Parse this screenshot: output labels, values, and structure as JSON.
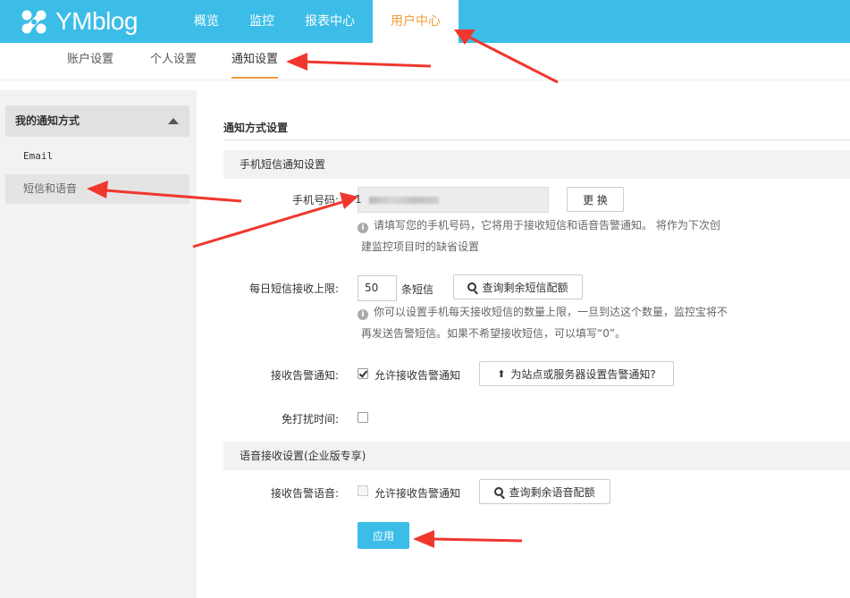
{
  "header": {
    "logo_text": "YMblog",
    "nav": [
      "概览",
      "监控",
      "报表中心",
      "用户中心"
    ],
    "active_nav": "用户中心"
  },
  "subnav": {
    "items": [
      "账户设置",
      "个人设置",
      "通知设置"
    ],
    "active": "通知设置"
  },
  "sidebar": {
    "title": "我的通知方式",
    "items": [
      "Email",
      "短信和语音"
    ],
    "active": "短信和语音"
  },
  "main": {
    "section_title": "通知方式设置",
    "sms_group": {
      "title": "手机短信通知设置",
      "phone_label": "手机号码:",
      "phone_value": "1",
      "change_button": "更 换",
      "phone_hint_line1": "请填写您的手机号码，它将用于接收短信和语音告警通知。 将作为下次创",
      "phone_hint_line2": "建监控项目时的缺省设置",
      "daily_limit_label": "每日短信接收上限:",
      "daily_limit_value": "50",
      "daily_limit_unit": "条短信",
      "query_sms_button": "查询剩余短信配额",
      "limit_hint_line1": "你可以设置手机每天接收短信的数量上限，一旦到达这个数量，监控宝将不",
      "limit_hint_line2": "再发送告警短信。如果不希望接收短信，可以填写“0”。",
      "receive_alert_label": "接收告警通知:",
      "receive_alert_checkbox": "允许接收告警通知",
      "receive_alert_checked": true,
      "set_alert_button": "为站点或服务器设置告警通知?",
      "dnd_label": "免打扰时间:",
      "dnd_checked": false
    },
    "voice_group": {
      "title": "语音接收设置(企业版专享)",
      "receive_voice_label": "接收告警语音:",
      "receive_voice_checkbox": "允许接收告警通知",
      "receive_voice_checked": false,
      "query_voice_button": "查询剩余语音配额"
    },
    "apply_button": "应用"
  },
  "colors": {
    "brand": "#3cbde8",
    "accent": "#f29b3b",
    "annotation_arrow": "#f0372e"
  }
}
